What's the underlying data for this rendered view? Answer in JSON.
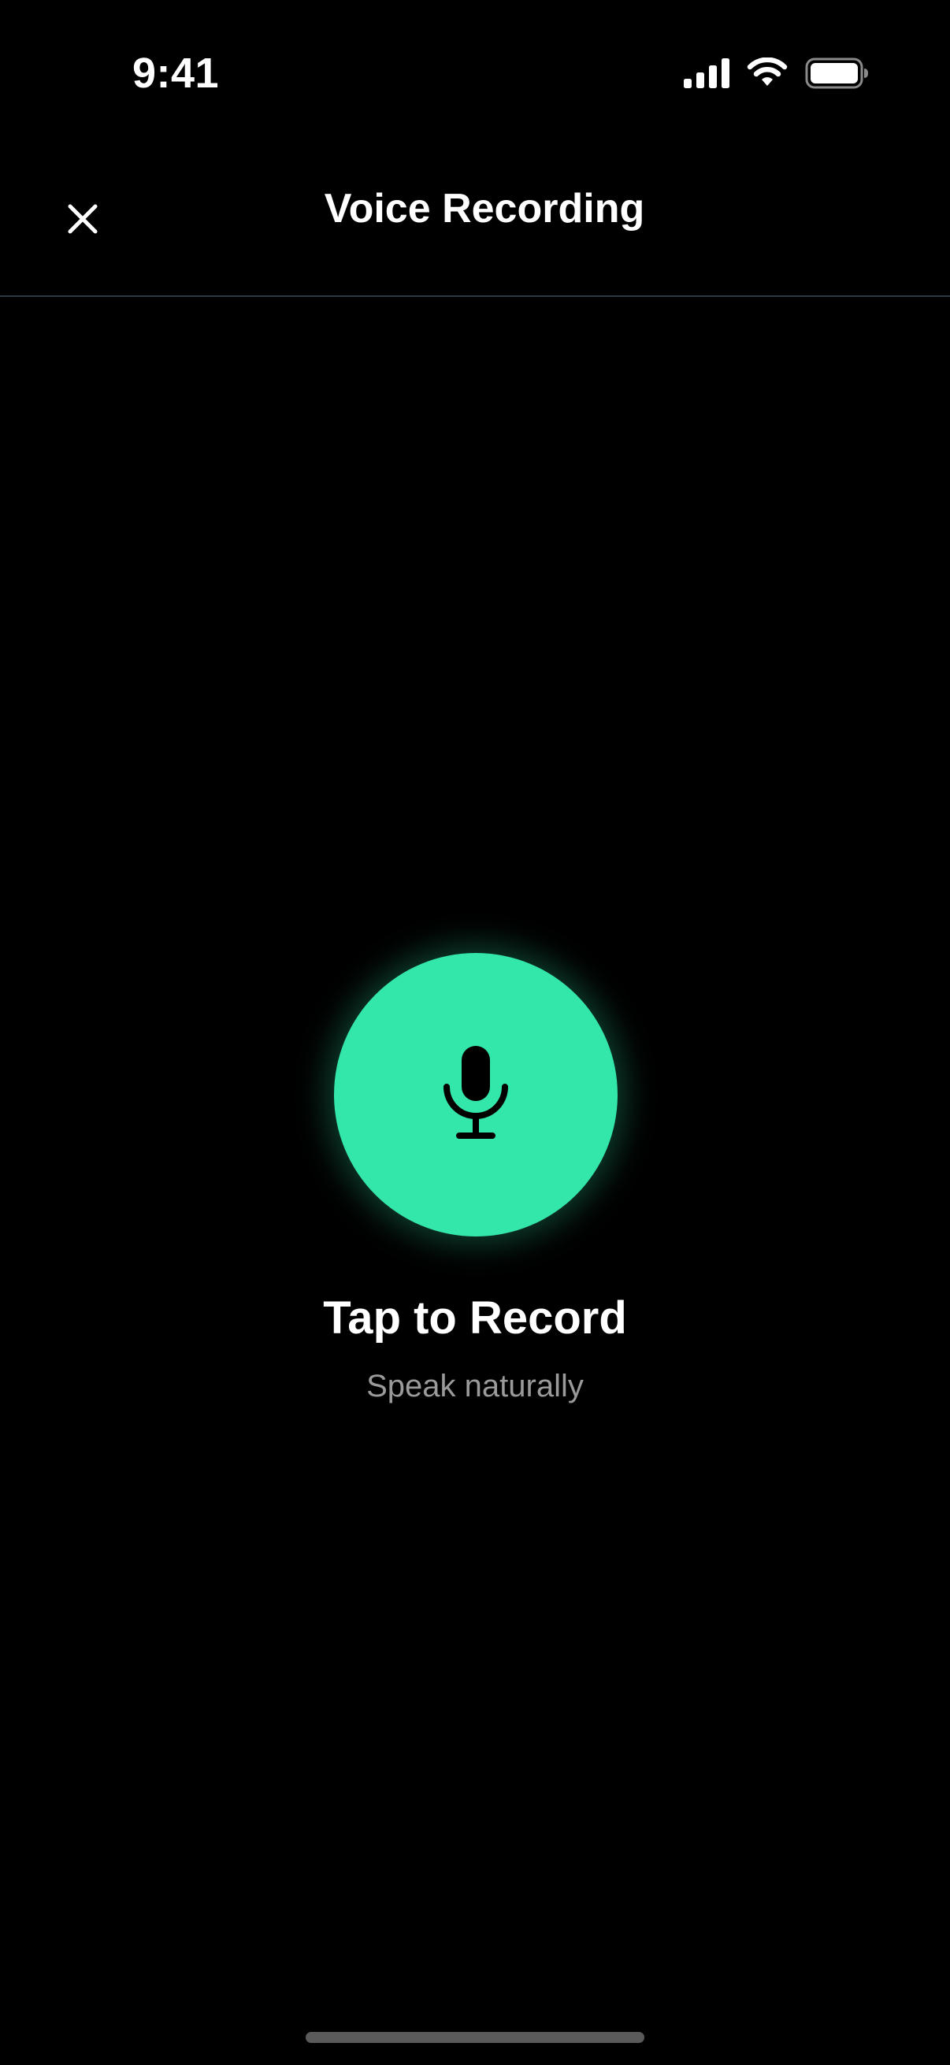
{
  "status_bar": {
    "time": "9:41",
    "icons": [
      "cellular-signal-icon",
      "wifi-icon",
      "battery-icon"
    ]
  },
  "header": {
    "title": "Voice Recording",
    "close_icon": "close-icon"
  },
  "recorder": {
    "button_icon": "microphone-icon",
    "title": "Tap to Record",
    "subtitle": "Speak naturally"
  },
  "colors": {
    "background": "#000000",
    "accent": "#33E6AA",
    "divider": "#2E3A47",
    "secondary_text": "#9A9A9A"
  }
}
